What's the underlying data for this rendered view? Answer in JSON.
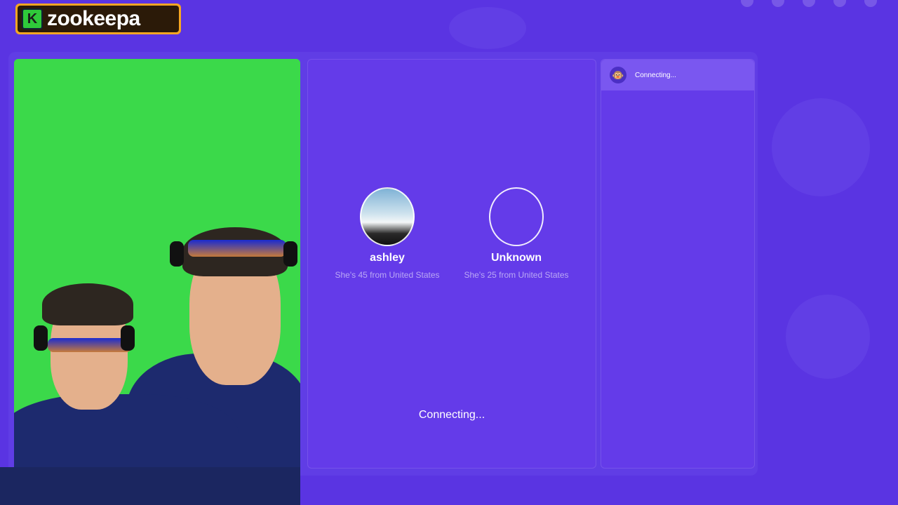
{
  "app": {
    "logo_letter": "K",
    "logo_text": "zookeepa",
    "brand_color": "#5a34e2",
    "accent_color": "#f5a623"
  },
  "match": {
    "profiles": [
      {
        "name": "ashley",
        "description": "She's 45 from United States",
        "avatar": "photo"
      },
      {
        "name": "Unknown",
        "description": "She's 25 from United States",
        "avatar": "empty"
      }
    ],
    "status": "Connecting..."
  },
  "chat": {
    "status": "Connecting...",
    "avatar_icon": "monkey-icon"
  }
}
